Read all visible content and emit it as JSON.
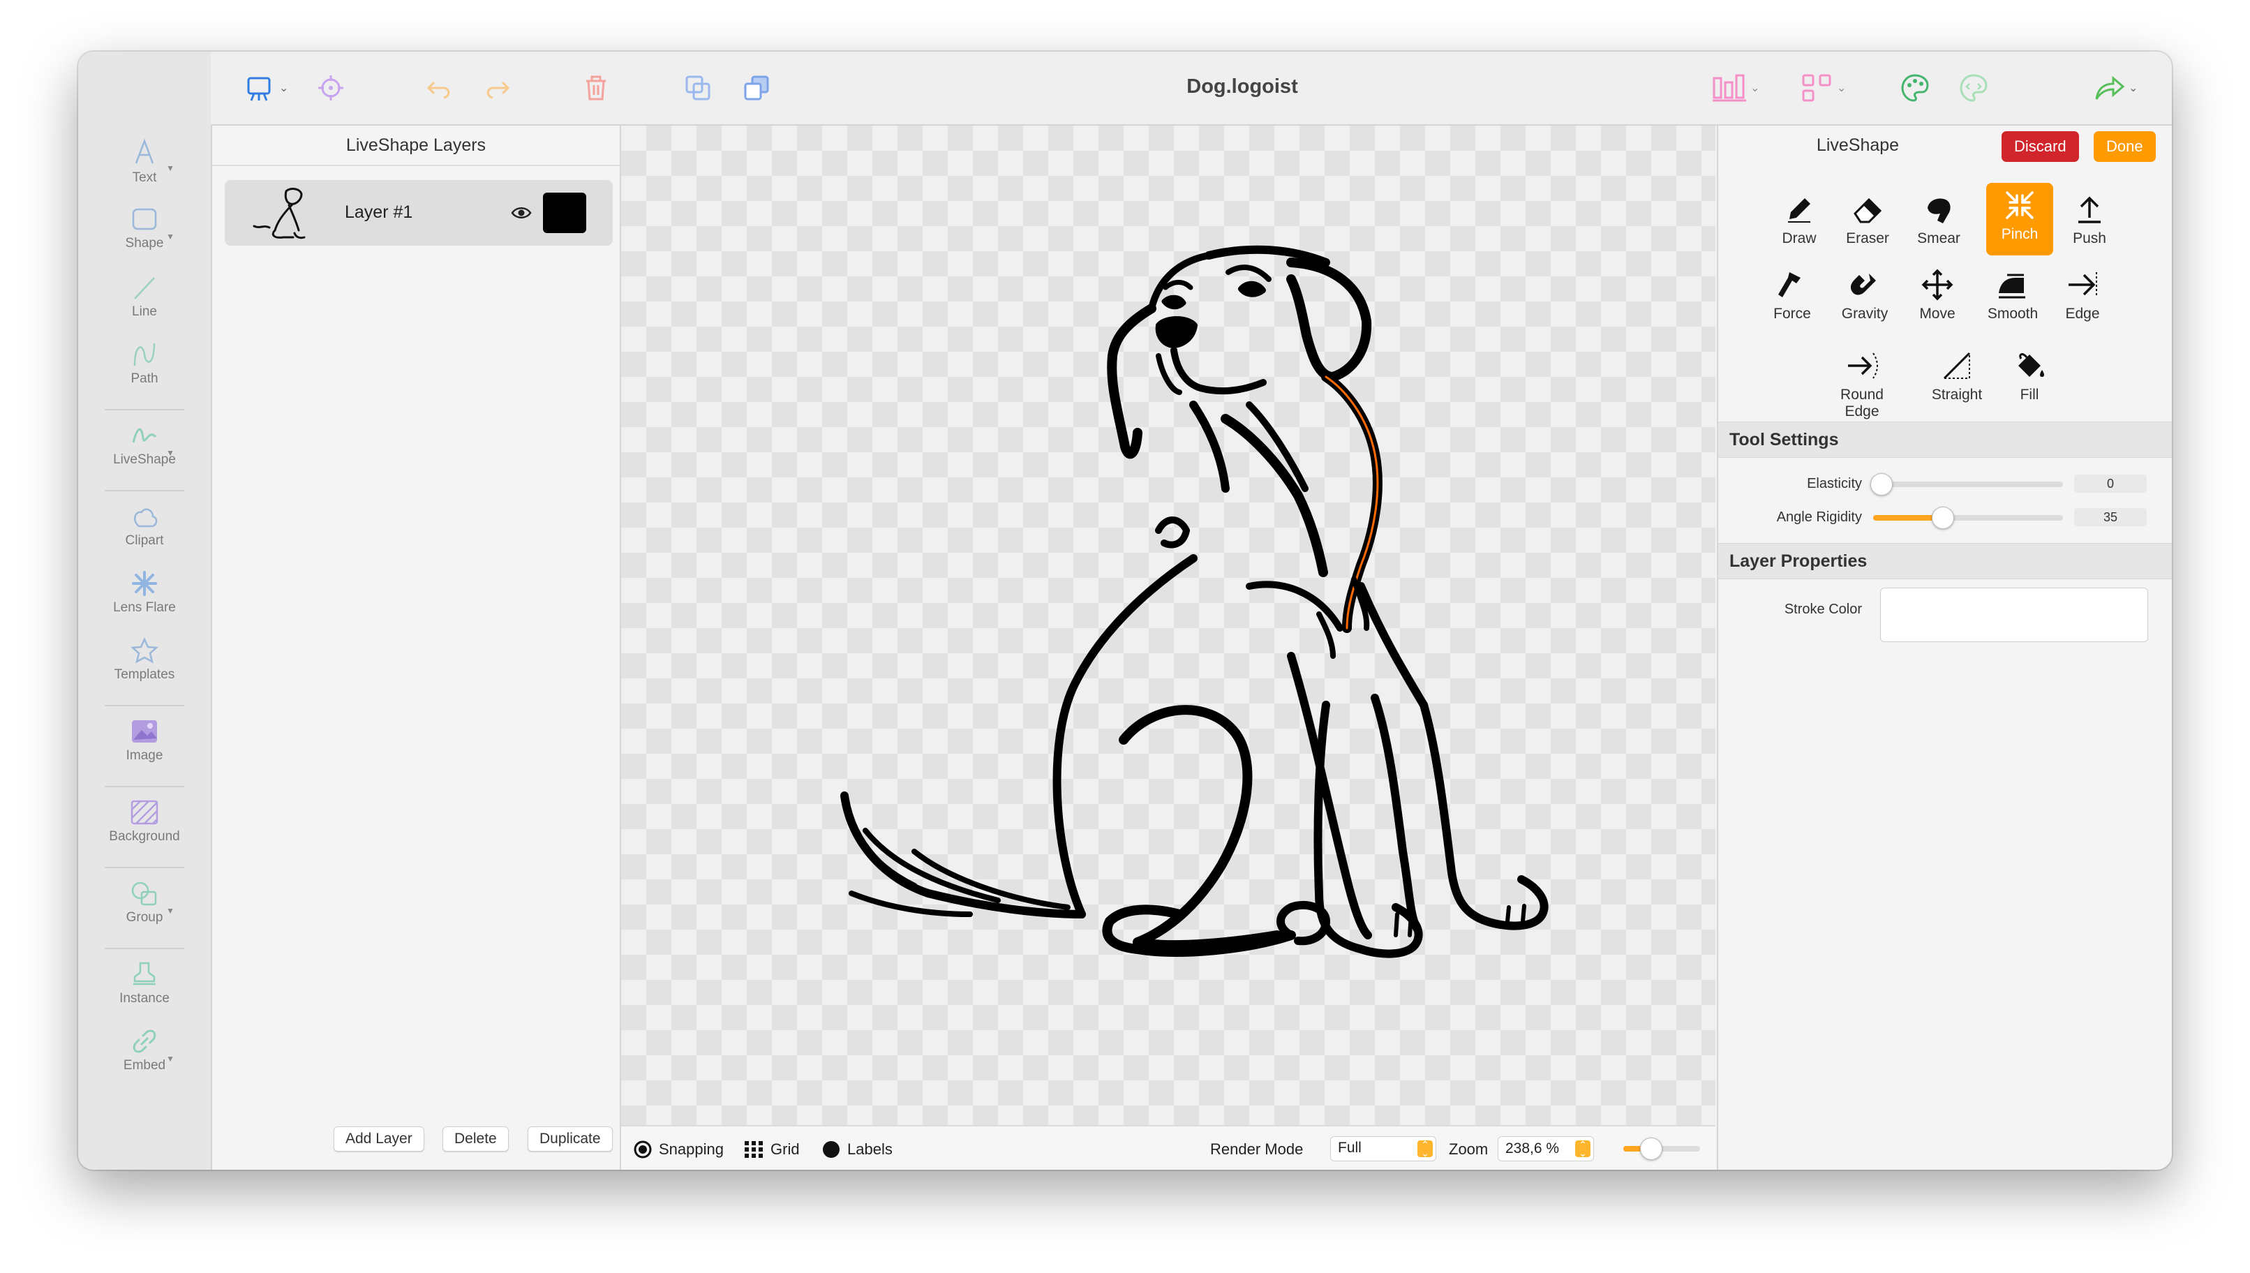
{
  "window": {
    "title": "Dog.logoist"
  },
  "colors": {
    "accent": "#ff9a00",
    "discard": "#d0262b",
    "selection_stroke": "#ff6a00"
  },
  "sidebar": {
    "tools": [
      {
        "label": "Text",
        "icon": "text-icon"
      },
      {
        "label": "Shape",
        "icon": "shape-icon"
      },
      {
        "label": "Line",
        "icon": "line-icon"
      },
      {
        "label": "Path",
        "icon": "path-icon"
      },
      {
        "label": "LiveShape",
        "icon": "liveshape-icon"
      },
      {
        "label": "Clipart",
        "icon": "clipart-icon"
      },
      {
        "label": "Lens Flare",
        "icon": "lens-flare-icon"
      },
      {
        "label": "Templates",
        "icon": "templates-icon"
      },
      {
        "label": "Image",
        "icon": "image-icon"
      },
      {
        "label": "Background",
        "icon": "background-icon"
      },
      {
        "label": "Group",
        "icon": "group-icon"
      },
      {
        "label": "Instance",
        "icon": "instance-icon"
      },
      {
        "label": "Embed",
        "icon": "embed-icon"
      }
    ]
  },
  "layers_panel": {
    "title": "LiveShape Layers",
    "layers": [
      {
        "name": "Layer #1",
        "visible": true,
        "color": "#000000"
      }
    ],
    "buttons": {
      "add": "Add Layer",
      "delete": "Delete",
      "duplicate": "Duplicate"
    }
  },
  "statusbar": {
    "snapping": "Snapping",
    "grid": "Grid",
    "labels": "Labels",
    "render_mode_label": "Render Mode",
    "render_mode_value": "Full",
    "zoom_label": "Zoom",
    "zoom_value": "238,6 %",
    "zoom_slider": 0.35
  },
  "liveshape_panel": {
    "title": "LiveShape",
    "discard": "Discard",
    "done": "Done",
    "tools_row1": [
      "Draw",
      "Eraser",
      "Smear",
      "Pinch",
      "Push"
    ],
    "tools_row2": [
      "Force",
      "Gravity",
      "Move",
      "Smooth",
      "Edge"
    ],
    "tools_row3": [
      "Round Edge",
      "Straight",
      "Fill"
    ],
    "active_tool": "Pinch",
    "tool_settings": {
      "title": "Tool Settings",
      "elasticity_label": "Elasticity",
      "elasticity_value": "0",
      "angle_label": "Angle Rigidity",
      "angle_value": "35"
    },
    "layer_properties": {
      "title": "Layer Properties",
      "stroke_label": "Stroke Color"
    }
  }
}
